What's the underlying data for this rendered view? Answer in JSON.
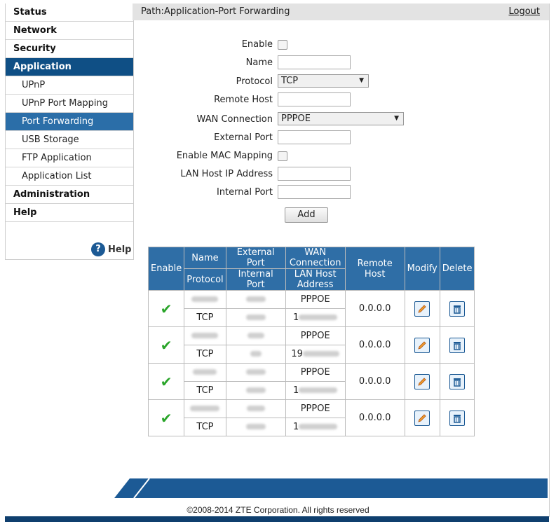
{
  "nav": {
    "status": "Status",
    "network": "Network",
    "security": "Security",
    "application": "Application",
    "sub": [
      "UPnP",
      "UPnP Port Mapping",
      "Port Forwarding",
      "USB Storage",
      "FTP Application",
      "Application List"
    ],
    "administration": "Administration",
    "help": "Help"
  },
  "help_widget": {
    "icon_glyph": "?",
    "label": "Help"
  },
  "header": {
    "path": "Path:Application-Port Forwarding",
    "logout": "Logout"
  },
  "form": {
    "enable_label": "Enable",
    "name_label": "Name",
    "protocol_label": "Protocol",
    "protocol_value": "TCP",
    "remote_host_label": "Remote Host",
    "wan_connection_label": "WAN Connection",
    "wan_connection_value": "PPPOE",
    "external_port_label": "External Port",
    "enable_mac_label": "Enable MAC Mapping",
    "lan_host_ip_label": "LAN Host IP Address",
    "internal_port_label": "Internal Port",
    "add_button": "Add"
  },
  "table": {
    "headers": {
      "enable": "Enable",
      "name": "Name",
      "protocol": "Protocol",
      "external_port": "External Port",
      "internal_port": "Internal Port",
      "wan_connection": "WAN Connection",
      "lan_host_address": "LAN Host Address",
      "remote_host": "Remote Host",
      "modify": "Modify",
      "delete": "Delete"
    },
    "rows": [
      {
        "protocol": "TCP",
        "wan": "PPPOE",
        "ip_prefix": "1",
        "remote_host": "0.0.0.0"
      },
      {
        "protocol": "TCP",
        "wan": "PPPOE",
        "ip_prefix": "19",
        "remote_host": "0.0.0.0"
      },
      {
        "protocol": "TCP",
        "wan": "PPPOE",
        "ip_prefix": "1",
        "remote_host": "0.0.0.0"
      },
      {
        "protocol": "TCP",
        "wan": "PPPOE",
        "ip_prefix": "1",
        "remote_host": "0.0.0.0"
      }
    ]
  },
  "footer": {
    "copyright": "©2008-2014 ZTE Corporation. All rights reserved"
  },
  "colors": {
    "nav_active": "#0f4f85",
    "nav_sub_active": "#2b6ea8",
    "table_header": "#2f6ea6",
    "footer": "#1c5a95",
    "check": "#2aa52a"
  }
}
